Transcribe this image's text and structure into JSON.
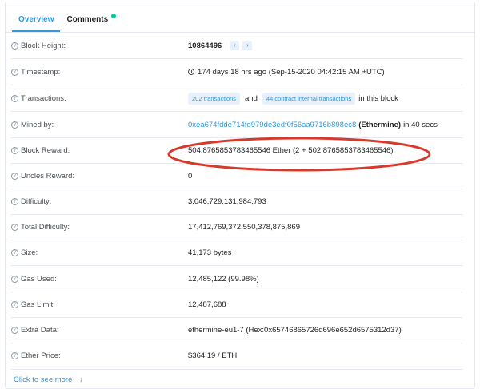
{
  "tabs": [
    {
      "label": "Overview",
      "active": true
    },
    {
      "label": "Comments",
      "active": false
    }
  ],
  "rows": [
    {
      "label": "Block Height:",
      "value": "10864496"
    },
    {
      "label": "Timestamp:",
      "value": "174 days 18 hrs ago (Sep-15-2020 04:42:15 AM +UTC)"
    },
    {
      "label": "Transactions:",
      "tx_pill": "202 transactions",
      "and": "and",
      "internal_pill": "44 contract internal transactions",
      "suffix": "in this block"
    },
    {
      "label": "Mined by:",
      "address": "0xea674fdde714fd979de3edf0f56aa9716b898ec8",
      "miner": "(Ethermine)",
      "suffix": "in 40 secs"
    },
    {
      "label": "Block Reward:",
      "value": "504.8765853783465546 Ether (2 + 502.8765853783465546)"
    },
    {
      "label": "Uncles Reward:",
      "value": "0"
    },
    {
      "label": "Difficulty:",
      "value": "3,046,729,131,984,793"
    },
    {
      "label": "Total Difficulty:",
      "value": "17,412,769,372,550,378,875,869"
    },
    {
      "label": "Size:",
      "value": "41,173 bytes"
    },
    {
      "label": "Gas Used:",
      "value": "12,485,122 (99.98%)"
    },
    {
      "label": "Gas Limit:",
      "value": "12,487,688"
    },
    {
      "label": "Extra Data:",
      "value": "ethermine-eu1-7 (Hex:0x65746865726d696e652d6575312d37)"
    },
    {
      "label": "Ether Price:",
      "value": "$364.19 / ETH"
    }
  ],
  "more_label": "Click to see more",
  "more_arrow": "↓",
  "nav": {
    "prev": "‹",
    "next": "›"
  },
  "help_icon_glyph": "?",
  "colors": {
    "accent": "#3498db",
    "annotation": "#d63a2c",
    "comments_dot": "#00c9a7"
  }
}
